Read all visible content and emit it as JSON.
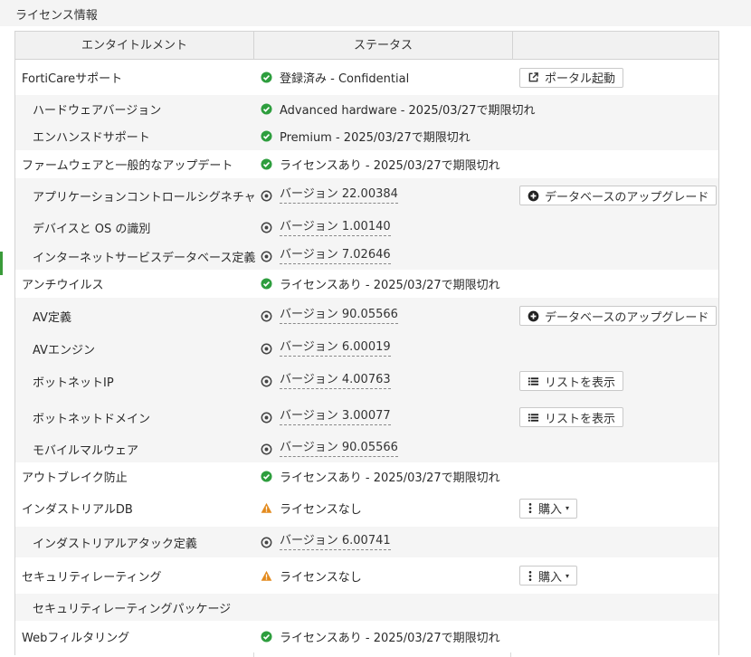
{
  "section": {
    "title": "ライセンス情報"
  },
  "table": {
    "headers": {
      "entitlement": "エンタイトルメント",
      "status": "ステータス"
    },
    "rows": [
      {
        "name": "FortiCareサポート",
        "status": "登録済み - Confidential",
        "icon": "check-circle-icon",
        "action": "ポータル起動",
        "action_icon": "external-link-icon"
      },
      {
        "name": "ハードウェアバージョン",
        "status": "Advanced hardware - 2025/03/27で期限切れ",
        "icon": "check-circle-icon"
      },
      {
        "name": "エンハンスドサポート",
        "status": "Premium - 2025/03/27で期限切れ",
        "icon": "check-circle-icon"
      },
      {
        "name": "ファームウェアと一般的なアップデート",
        "status": "ライセンスあり - 2025/03/27で期限切れ",
        "icon": "check-circle-icon"
      },
      {
        "name": "アプリケーションコントロールシグネチャ",
        "status": "バージョン 22.00384",
        "icon": "target-icon",
        "action": "データベースのアップグレード",
        "action_icon": "plus-circle-icon"
      },
      {
        "name": "デバイスと OS の識別",
        "status": "バージョン 1.00140",
        "icon": "target-icon"
      },
      {
        "name": "インターネットサービスデータベース定義",
        "status": "バージョン 7.02646",
        "icon": "target-icon"
      },
      {
        "name": "アンチウイルス",
        "status": "ライセンスあり - 2025/03/27で期限切れ",
        "icon": "check-circle-icon"
      },
      {
        "name": "AV定義",
        "status": "バージョン 90.05566",
        "icon": "target-icon",
        "action": "データベースのアップグレード",
        "action_icon": "plus-circle-icon"
      },
      {
        "name": "AVエンジン",
        "status": "バージョン 6.00019",
        "icon": "target-icon"
      },
      {
        "name": "ボットネットIP",
        "status": "バージョン 4.00763",
        "icon": "target-icon",
        "action": "リストを表示",
        "action_icon": "list-icon"
      },
      {
        "name": "ボットネットドメイン",
        "status": "バージョン 3.00077",
        "icon": "target-icon",
        "action": "リストを表示",
        "action_icon": "list-icon"
      },
      {
        "name": "モバイルマルウェア",
        "status": "バージョン 90.05566",
        "icon": "target-icon"
      },
      {
        "name": "アウトブレイク防止",
        "status": "ライセンスあり - 2025/03/27で期限切れ",
        "icon": "check-circle-icon"
      },
      {
        "name": "インダストリアルDB",
        "status": "ライセンスなし",
        "icon": "warning-icon",
        "action": "購入",
        "action_icon": "vertical-dots-icon"
      },
      {
        "name": "インダストリアルアタック定義",
        "status": "バージョン 6.00741",
        "icon": "target-icon"
      },
      {
        "name": "セキュリティレーティング",
        "status": "ライセンスなし",
        "icon": "warning-icon",
        "action": "購入",
        "action_icon": "vertical-dots-icon"
      },
      {
        "name": "セキュリティレーティングパッケージ",
        "status": "",
        "icon": ""
      },
      {
        "name": "Webフィルタリング",
        "status": "ライセンスあり - 2025/03/27で期限切れ",
        "icon": "check-circle-icon"
      }
    ]
  },
  "colors": {
    "ok": "#2e9e3e",
    "warning": "#e38a1d",
    "text": "#2b2b2b",
    "border": "#d3d3d3"
  }
}
